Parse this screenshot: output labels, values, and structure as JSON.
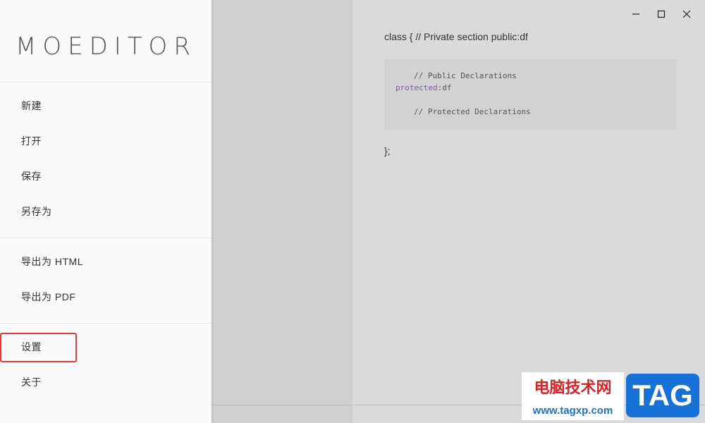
{
  "window": {
    "controls": [
      "minimize-icon",
      "maximize-icon",
      "close-icon"
    ]
  },
  "sidebar": {
    "logo": "MOEDITOR",
    "items": [
      {
        "label": "新建"
      },
      {
        "label": "打开"
      },
      {
        "label": "保存"
      },
      {
        "label": "另存为"
      },
      {
        "label": "导出为 HTML"
      },
      {
        "label": "导出为 PDF"
      },
      {
        "label": "设置"
      },
      {
        "label": "关于"
      }
    ]
  },
  "preview": {
    "line1": "class { // Private section public:df",
    "code": {
      "line1": "// Public Declarations",
      "keyword": "protected",
      "line2_rest": ":df",
      "line3": "// Protected Declarations"
    },
    "end": "};"
  },
  "watermark": {
    "cn": "电脑技术网",
    "url": "www.tagxp.com",
    "tag": "TAG"
  },
  "colors": {
    "highlight": "#ee3333",
    "keyword": "#7a5ba8",
    "tag_bg": "#1672d9"
  }
}
